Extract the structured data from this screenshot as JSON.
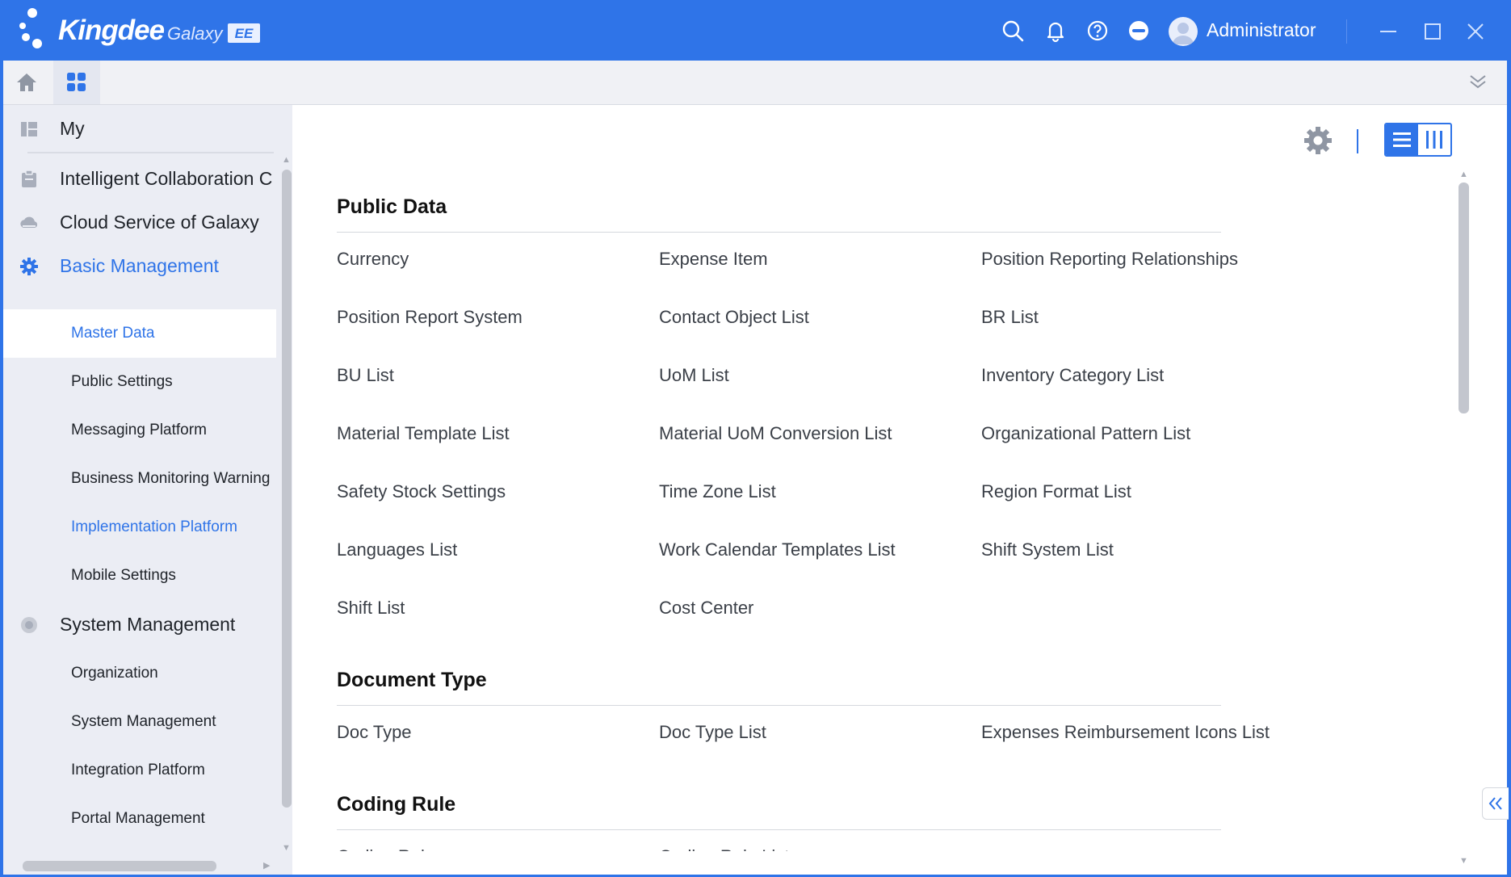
{
  "brand": {
    "name": "Kingdee",
    "product": "Galaxy",
    "edition": "EE"
  },
  "header": {
    "user_name": "Administrator",
    "icons": [
      "search-icon",
      "bell-icon",
      "help-icon",
      "more-icon",
      "avatar"
    ],
    "window_controls": [
      "minimize-icon",
      "maximize-icon",
      "close-icon"
    ]
  },
  "tabs": [
    {
      "icon": "home-icon",
      "active": false
    },
    {
      "icon": "apps-grid-icon",
      "active": true
    }
  ],
  "sidebar": {
    "my_label": "My",
    "items": [
      {
        "label": "Intelligent Collaboration C",
        "icon": "clipboard-icon"
      },
      {
        "label": "Cloud Service of Galaxy",
        "icon": "cloud-icon"
      },
      {
        "label": "Basic Management",
        "icon": "gear-icon",
        "active": true
      },
      {
        "label": "System Management",
        "icon": "system-icon"
      }
    ],
    "basic_children": [
      {
        "label": "Master Data",
        "selected": true
      },
      {
        "label": "Public Settings"
      },
      {
        "label": "Messaging Platform"
      },
      {
        "label": "Business Monitoring Warning"
      },
      {
        "label": "Implementation Platform",
        "highlight": true
      },
      {
        "label": "Mobile Settings"
      }
    ],
    "system_children": [
      {
        "label": "Organization"
      },
      {
        "label": "System Management"
      },
      {
        "label": "Integration Platform"
      },
      {
        "label": "Portal Management"
      }
    ]
  },
  "main": {
    "sections": [
      {
        "title": "Public Data",
        "items": [
          "Currency",
          "Expense Item",
          "Position Reporting Relationships",
          "Position Report System",
          "Contact Object List",
          "BR List",
          "BU List",
          "UoM List",
          "Inventory Category List",
          "Material Template List",
          "Material UoM Conversion List",
          "Organizational Pattern List",
          "Safety Stock Settings",
          "Time Zone List",
          "Region Format List",
          "Languages List",
          "Work Calendar Templates List",
          "Shift System List",
          "Shift List",
          "Cost Center"
        ]
      },
      {
        "title": "Document Type",
        "items": [
          "Doc Type",
          "Doc Type List",
          "Expenses Reimbursement Icons List"
        ]
      },
      {
        "title": "Coding Rule",
        "items": [
          "Coding Rule",
          "Coding Rule List"
        ]
      }
    ]
  },
  "colors": {
    "brand_blue": "#2f74e8",
    "sidebar_bg": "#ebedf4",
    "text": "#3a3f47"
  }
}
